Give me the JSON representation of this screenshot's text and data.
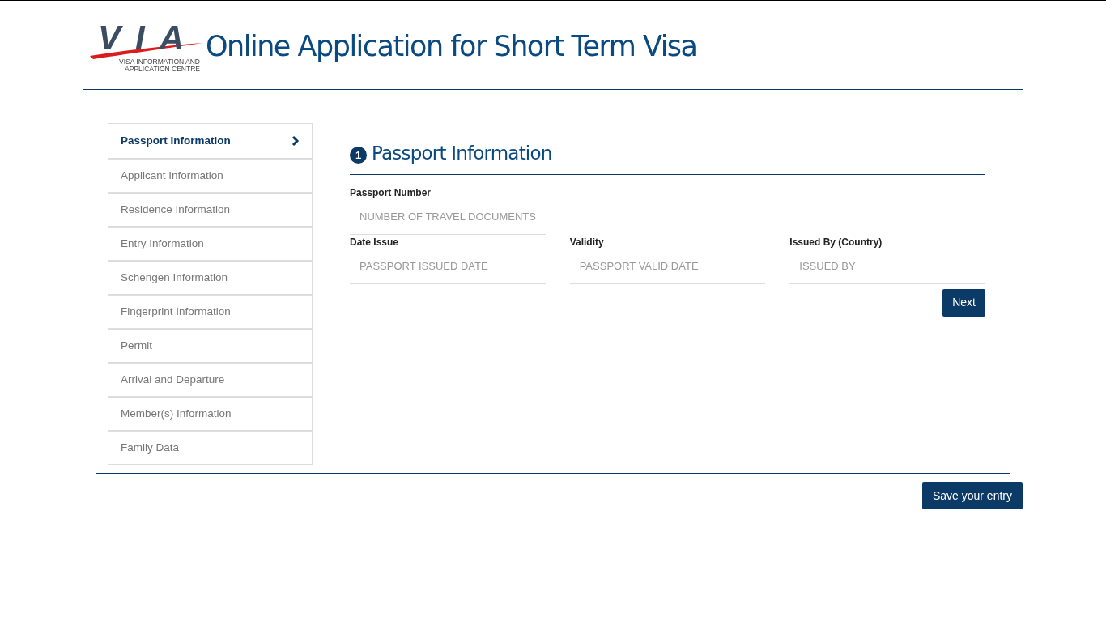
{
  "header": {
    "logo": {
      "letters": "VIA",
      "caption_lines": [
        "VISA INFORMATION AND",
        "APPLICATION CENTRE"
      ]
    },
    "title": "Online Application for Short Term Visa"
  },
  "sidebar": {
    "items": [
      {
        "label": "Passport Information",
        "selected": true
      },
      {
        "label": "Applicant Information",
        "selected": false
      },
      {
        "label": "Residence Information",
        "selected": false
      },
      {
        "label": "Entry Information",
        "selected": false
      },
      {
        "label": "Schengen Information",
        "selected": false
      },
      {
        "label": "Fingerprint Information",
        "selected": false
      },
      {
        "label": "Permit",
        "selected": false
      },
      {
        "label": "Arrival and Departure",
        "selected": false
      },
      {
        "label": "Member(s) Information",
        "selected": false
      },
      {
        "label": "Family Data",
        "selected": false
      }
    ]
  },
  "section": {
    "step": "1",
    "title": "Passport Information",
    "rows": [
      [
        {
          "label": "Passport Number",
          "placeholder": "NUMBER OF TRAVEL DOCUMENTS"
        }
      ],
      [
        {
          "label": "Date Issue",
          "placeholder": "PASSPORT ISSUED DATE"
        },
        {
          "label": "Validity",
          "placeholder": "PASSPORT VALID DATE"
        },
        {
          "label": "Issued By (Country)",
          "placeholder": "ISSUED BY"
        }
      ]
    ],
    "next_button": "Next"
  },
  "save_button": "Save your entry"
}
